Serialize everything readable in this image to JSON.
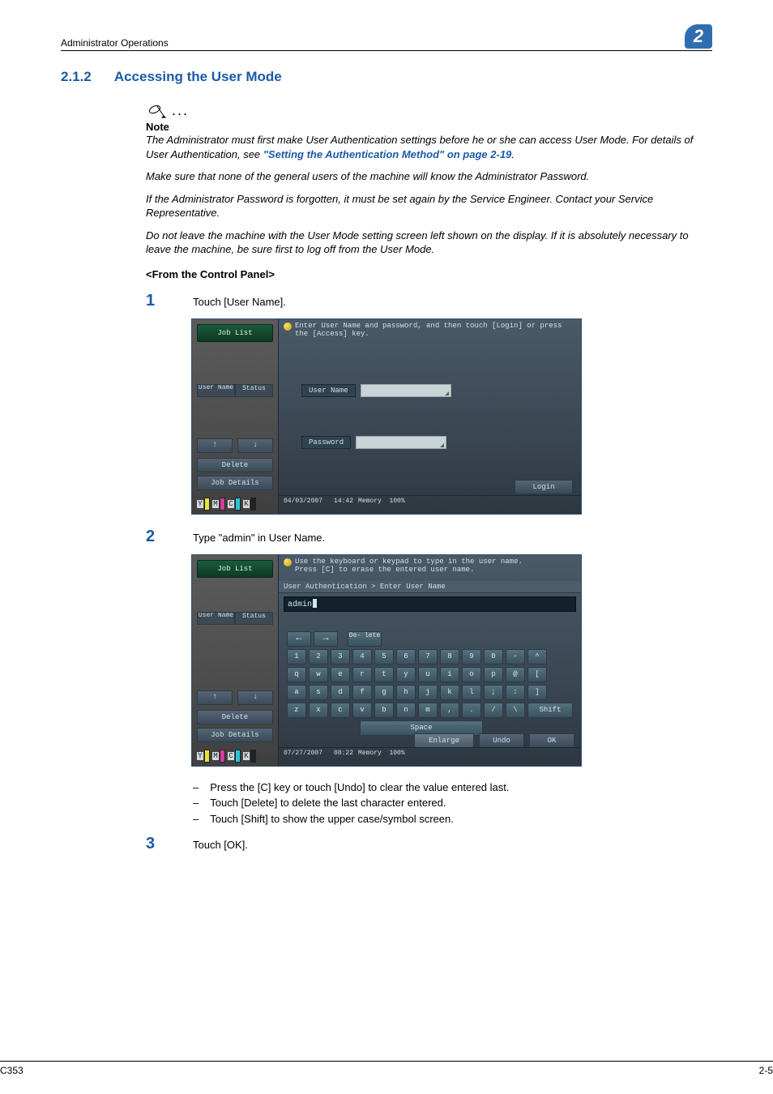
{
  "header": {
    "section_path": "Administrator Operations",
    "chapter_number": "2"
  },
  "section": {
    "number": "2.1.2",
    "title": "Accessing the User Mode"
  },
  "note": {
    "label": "Note",
    "p1_pre": "The Administrator must first make User Authentication settings before he or she can access User Mode. For details of User Authentication, see ",
    "p1_link": "\"Setting the Authentication Method\" on page 2-19",
    "p1_post": ".",
    "p2": "Make sure that none of the general users of the machine will know the Administrator Password.",
    "p3": "If the Administrator Password is forgotten, it must be set again by the Service Engineer. Contact your Service Representative.",
    "p4": "Do not leave the machine with the User Mode setting screen left shown on the display. If it is absolutely necessary to leave the machine, be sure first to log off from the User Mode."
  },
  "subhead": "<From the Control Panel>",
  "steps": {
    "s1": {
      "num": "1",
      "text": "Touch [User Name]."
    },
    "s2": {
      "num": "2",
      "text": "Type \"admin\" in User Name."
    },
    "s3": {
      "num": "3",
      "text": "Touch [OK]."
    }
  },
  "bullets": {
    "b1": "Press the [C] key or touch [Undo] to clear the value entered last.",
    "b2": "Touch [Delete] to delete the last character entered.",
    "b3": "Touch [Shift] to show the upper case/symbol screen."
  },
  "panel_common": {
    "job_list": "Job List",
    "user_name_tab": "User Name",
    "status_tab": "Status",
    "delete_btn": "Delete",
    "job_details_btn": "Job Details",
    "memory_label": "Memory",
    "memory_pct": "100%"
  },
  "panel1": {
    "hint": "Enter User Name and password, and then touch [Login] or press the [Access] key.",
    "user_label": "User Name",
    "pass_label": "Password",
    "login_btn": "Login",
    "date": "04/03/2007",
    "time": "14:42"
  },
  "panel2": {
    "hint_l1": "Use the keyboard or keypad to type in the user name.",
    "hint_l2": "Press [C] to erase the entered user name.",
    "crumb": "User Authentication > Enter User Name",
    "entered_value": "admin",
    "delete_key": "De- lete",
    "shift_key": "Shift",
    "space_key": "Space",
    "enlarge_btn": "Enlarge",
    "undo_btn": "Undo",
    "ok_btn": "OK",
    "date": "07/27/2007",
    "time": "08:22",
    "row_num": [
      "1",
      "2",
      "3",
      "4",
      "5",
      "6",
      "7",
      "8",
      "9",
      "0",
      "-",
      "^"
    ],
    "row_q": [
      "q",
      "w",
      "e",
      "r",
      "t",
      "y",
      "u",
      "i",
      "o",
      "p",
      "@",
      "["
    ],
    "row_a": [
      "a",
      "s",
      "d",
      "f",
      "g",
      "h",
      "j",
      "k",
      "l",
      ";",
      ":",
      "]"
    ],
    "row_z": [
      "z",
      "x",
      "c",
      "v",
      "b",
      "n",
      "m",
      ",",
      ".",
      "/",
      "\\"
    ]
  },
  "footer": {
    "model": "C353",
    "page": "2-5"
  }
}
